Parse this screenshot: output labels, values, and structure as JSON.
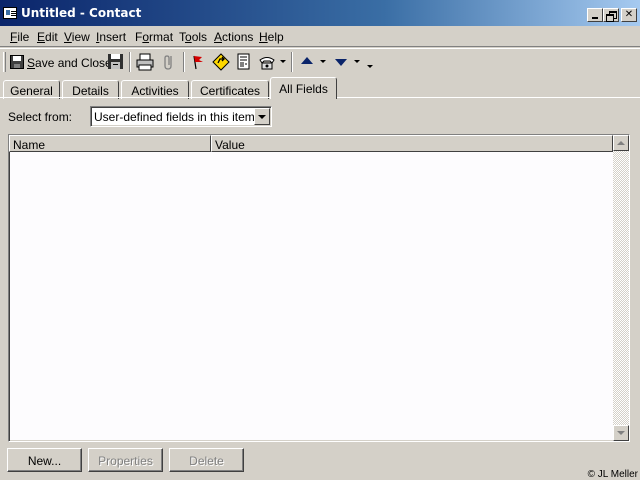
{
  "window": {
    "title": "Untitled - Contact",
    "icon": "contact-card-icon",
    "controls": [
      "minimize-icon",
      "restore-icon",
      "close-icon"
    ]
  },
  "menubar": {
    "items": [
      {
        "label": "File",
        "mnemonic": "F",
        "rest": "ile"
      },
      {
        "label": "Edit",
        "mnemonic": "E",
        "rest": "dit"
      },
      {
        "label": "View",
        "mnemonic": "V",
        "rest": "iew"
      },
      {
        "label": "Insert",
        "mnemonic": "I",
        "rest": "nsert"
      },
      {
        "label": "Format",
        "mnemonic": "F",
        "rest": "ormat",
        "pre": ""
      },
      {
        "label": "Tools",
        "mnemonic": "T",
        "rest": "ools"
      },
      {
        "label": "Actions",
        "mnemonic": "A",
        "rest": "ctions"
      },
      {
        "label": "Help",
        "mnemonic": "H",
        "rest": "elp"
      }
    ]
  },
  "toolbar": {
    "save_close_label": "Save and Close",
    "save_close_mnemonic": "S",
    "save_close_rest": "ave and Close",
    "icons": [
      "save-icon",
      "print-icon",
      "attach-icon",
      "flag-icon",
      "address-check-icon",
      "new-letter-icon",
      "dial-phone-icon",
      "previous-item-icon",
      "next-item-icon",
      "toolbar-options-icon"
    ]
  },
  "tabs": [
    {
      "label": "General",
      "active": false
    },
    {
      "label": "Details",
      "active": false
    },
    {
      "label": "Activities",
      "active": false
    },
    {
      "label": "Certificates",
      "active": false
    },
    {
      "label": "All Fields",
      "active": true
    }
  ],
  "select_from": {
    "label": "Select from:",
    "value": "User-defined fields in this item"
  },
  "field_list": {
    "columns": [
      "Name",
      "Value"
    ],
    "rows": []
  },
  "buttons": {
    "new": {
      "label": "New...",
      "enabled": true
    },
    "properties": {
      "label": "Properties",
      "enabled": false
    },
    "delete": {
      "label": "Delete",
      "enabled": false
    }
  },
  "copyright": "© JL Meller"
}
